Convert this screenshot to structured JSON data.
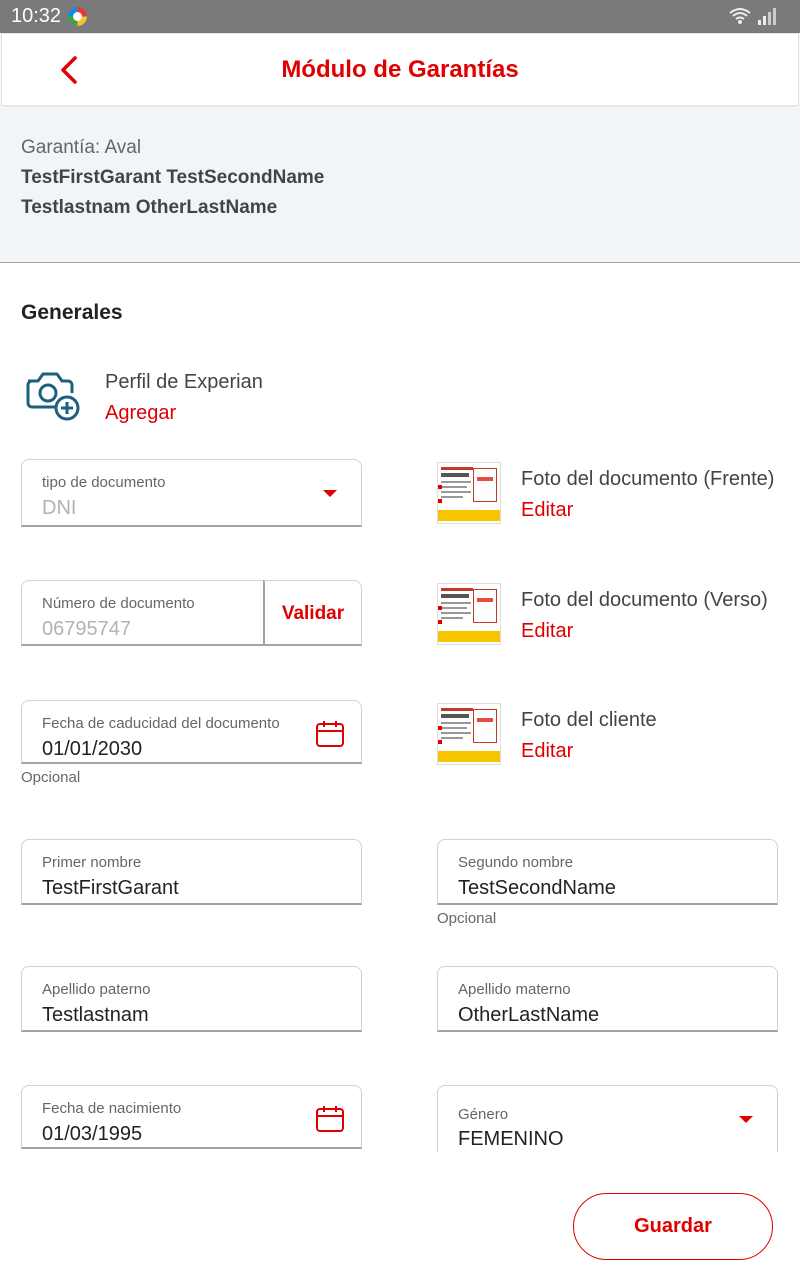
{
  "status_bar": {
    "time": "10:32",
    "app_icon": "browser-app-icon",
    "wifi_icon": "wifi-icon",
    "signal_icon": "signal-icon"
  },
  "app_bar": {
    "title": "Módulo de Garantías",
    "back_icon": "chevron-left-icon",
    "accent_color": "#e00000"
  },
  "summary": {
    "guarantee_type": "Garantía: Aval",
    "name_line1": "TestFirstGarant TestSecondName",
    "name_line2": "Testlastnam OtherLastName"
  },
  "section": {
    "title": "Generales"
  },
  "experian": {
    "label": "Perfil de Experian",
    "action": "Agregar",
    "icon": "camera-add-icon"
  },
  "document": {
    "type": {
      "label": "tipo de documento",
      "value": "DNI"
    },
    "number": {
      "label": "Número de documento",
      "value": "06795747",
      "validate_label": "Validar"
    },
    "expiry": {
      "label": "Fecha de caducidad del documento",
      "value": "01/01/2030",
      "hint": "Opcional"
    }
  },
  "photos": [
    {
      "label": "Foto del documento (Frente)",
      "action": "Editar"
    },
    {
      "label": "Foto del documento (Verso)",
      "action": "Editar"
    },
    {
      "label": "Foto del cliente",
      "action": "Editar"
    }
  ],
  "person": {
    "first_name": {
      "label": "Primer nombre",
      "value": "TestFirstGarant"
    },
    "second_name": {
      "label": "Segundo nombre",
      "value": "TestSecondName",
      "hint": "Opcional"
    },
    "paternal_last_name": {
      "label": "Apellido paterno",
      "value": "Testlastnam"
    },
    "maternal_last_name": {
      "label": "Apellido materno",
      "value": "OtherLastName"
    },
    "birth_date": {
      "label": "Fecha de nacimiento",
      "value": "01/03/1995"
    },
    "gender": {
      "label": "Género",
      "value": "FEMENINO"
    }
  },
  "actions": {
    "save_label": "Guardar"
  }
}
